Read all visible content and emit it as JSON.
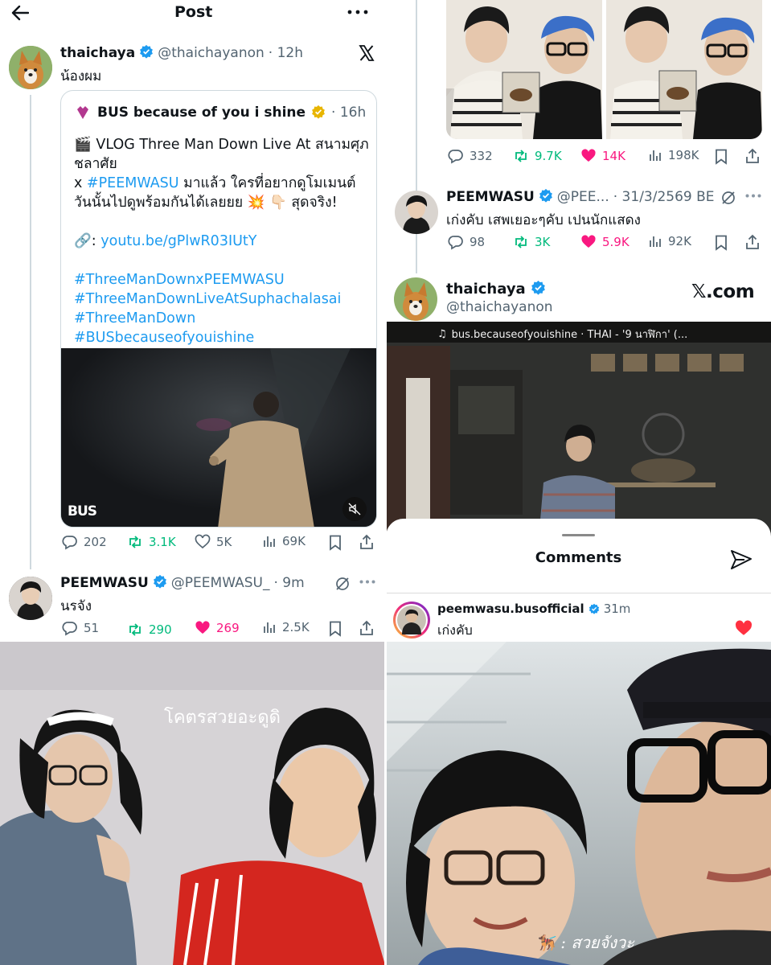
{
  "left_post": {
    "header_title": "Post",
    "author_name": "thaichaya",
    "author_handle": "@thaichayanon",
    "time": "· 12h",
    "text": "น้องผม",
    "quote": {
      "author_name": "BUS because of you i shine",
      "time": "· 16h",
      "lines": [
        "🎬 VLOG Three Man Down Live At สนามศุภ",
        "ชลาศัย",
        "x #PEEMWASU มาแล้ว ใครที่อยากดูโมเมนต์",
        "วันนั้นไปดูพร้อมกันได้เลยยย 💥 👇🏻 สุดจริง!",
        "",
        "🔗: youtu.be/gPlwR03IUtY",
        "",
        "#ThreeManDownxPEEMWASU",
        "#ThreeManDownLiveAtSuphachalasai",
        "#ThreeManDown",
        "#BUSbecauseofyouishine"
      ],
      "line_colors": [
        "dark",
        "dark",
        "mixed",
        "dark",
        "dark",
        "mixed",
        "dark",
        "link",
        "link",
        "link",
        "link"
      ],
      "video_logo": "BUS"
    },
    "stats": {
      "replies": "202",
      "reposts": "3.1K",
      "likes": "5K",
      "views": "69K"
    },
    "reply": {
      "author_name": "PEEMWASU",
      "author_handle": "@PEEMWASU_",
      "time": "· 9m",
      "text": "นรจัง",
      "stats": {
        "replies": "51",
        "reposts": "290",
        "likes": "269",
        "views": "2.5K"
      }
    }
  },
  "right_top": {
    "stats": {
      "replies": "332",
      "reposts": "9.7K",
      "likes": "14K",
      "views": "198K"
    },
    "reply": {
      "author_name": "PEEMWASU",
      "author_handle": "@PEE...",
      "time": "· 31/3/2569 BE",
      "text": "เก่งคับ เสพเยอะๆคับ เปนนักแสดง",
      "stats": {
        "replies": "98",
        "reposts": "3K",
        "likes": "5.9K",
        "views": "92K"
      }
    }
  },
  "right_mid": {
    "author_name": "thaichaya",
    "author_handle": "@thaichayanon",
    "brand": "𝕏.com",
    "music": "bus.becauseofyouishine · THAI - '9 นาฬิกา' (...",
    "comments_title": "Comments",
    "comment": {
      "author": "peemwasu.busofficial",
      "time": "31m",
      "text": "เก่งคับ"
    }
  },
  "bottom_left": {
    "caption": "โคตรสวยอะดูดิ"
  },
  "bottom_right": {
    "caption": "🐕‍🦺 : สวยจังวะ"
  },
  "colors": {
    "link": "#1d9bf0",
    "verified": "#1d9bf0",
    "gold": "#e8b500",
    "repost_green": "#00ba7c",
    "like_pink": "#f91880",
    "muted": "#536471"
  }
}
